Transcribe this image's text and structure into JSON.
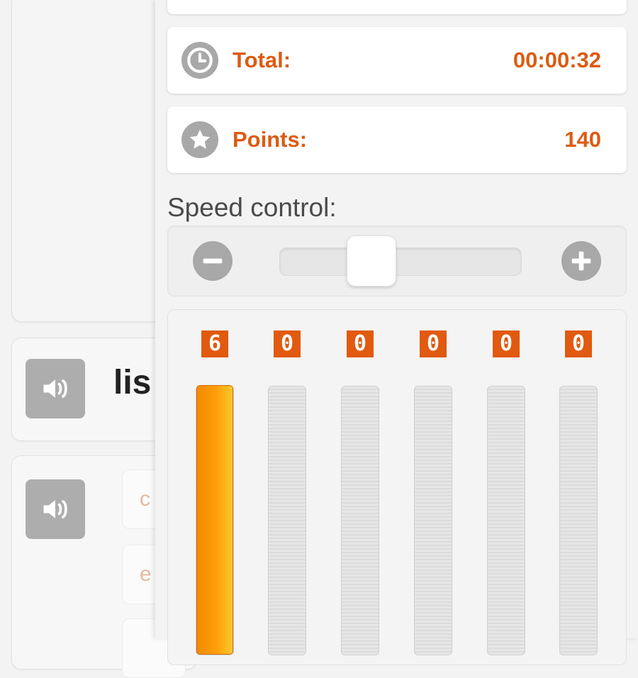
{
  "left": {
    "word": "lis",
    "options": [
      {
        "text": "c"
      },
      {
        "text": "e"
      },
      {
        "text": ""
      }
    ]
  },
  "stats": {
    "total": {
      "label": "Total:",
      "value": "00:00:32",
      "icon": "clock-icon"
    },
    "points": {
      "label": "Points:",
      "value": "140",
      "icon": "star-icon"
    }
  },
  "speed": {
    "label": "Speed control:",
    "level": 0.35
  },
  "bars": {
    "max_value": 10,
    "items": [
      {
        "badge": "6",
        "value": 6
      },
      {
        "badge": "0",
        "value": 0
      },
      {
        "badge": "0",
        "value": 0
      },
      {
        "badge": "0",
        "value": 0
      },
      {
        "badge": "0",
        "value": 0
      },
      {
        "badge": "0",
        "value": 0
      }
    ]
  },
  "colors": {
    "accent": "#dc5b12",
    "badge": "#e15a10",
    "bar_fill": "#f28a00",
    "icon_gray": "#a8a8a8"
  }
}
